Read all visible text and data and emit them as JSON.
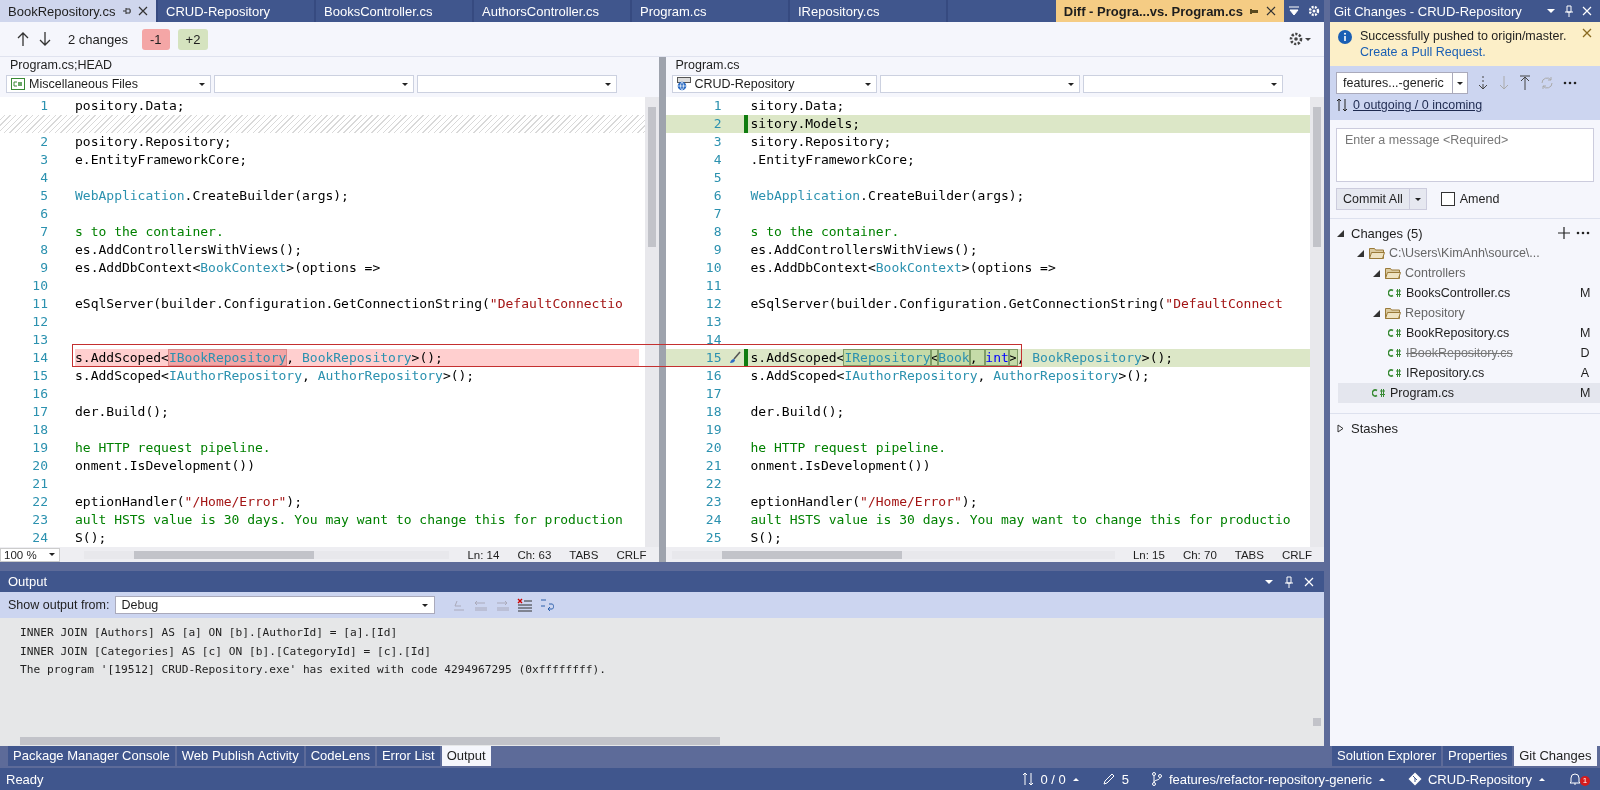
{
  "editor_tabs": [
    {
      "label": "BookRepository.cs",
      "selected": true,
      "pinned": true
    },
    {
      "label": "CRUD-Repository",
      "selected": false,
      "pinned": false
    },
    {
      "label": "BooksController.cs",
      "selected": false,
      "pinned": false
    },
    {
      "label": "AuthorsController.cs",
      "selected": false,
      "pinned": false
    },
    {
      "label": "Program.cs",
      "selected": false,
      "pinned": false
    },
    {
      "label": "IRepository.cs",
      "selected": false,
      "pinned": false
    }
  ],
  "diff_tab": {
    "label": "Diff - Progra...vs. Program.cs"
  },
  "diff_toolbar": {
    "changes": "2 changes",
    "removed": "-1",
    "added": "+2"
  },
  "panes": [
    {
      "title": "Program.cs;HEAD",
      "project": "Miscellaneous Files",
      "kind": "csharp",
      "zoom": "100 %",
      "status": [
        "Ln: 14",
        "Ch: 63",
        "TABS",
        "CRLF"
      ],
      "lines": [
        {
          "num": "1",
          "kind": "same",
          "segs": [
            {
              "text": "pository.Data;",
              "kind": "plain",
              "changed": false
            }
          ]
        },
        {
          "kind": "filler"
        },
        {
          "num": "2",
          "kind": "same",
          "segs": [
            {
              "text": "pository.Repository;",
              "kind": "plain",
              "changed": false
            }
          ]
        },
        {
          "num": "3",
          "kind": "same",
          "segs": [
            {
              "text": "e.EntityFrameworkCore;",
              "kind": "plain",
              "changed": false
            }
          ]
        },
        {
          "num": "4",
          "kind": "same"
        },
        {
          "num": "5",
          "kind": "same",
          "segs": [
            {
              "text": "WebApplication",
              "kind": "type",
              "changed": false
            },
            {
              "text": ".CreateBuilder(args);",
              "kind": "plain",
              "changed": false
            }
          ]
        },
        {
          "num": "6",
          "kind": "same"
        },
        {
          "num": "7",
          "kind": "same",
          "segs": [
            {
              "text": "s to the container.",
              "kind": "comment",
              "changed": false
            }
          ]
        },
        {
          "num": "8",
          "kind": "same",
          "segs": [
            {
              "text": "es.AddControllersWithViews();",
              "kind": "plain",
              "changed": false
            }
          ]
        },
        {
          "num": "9",
          "kind": "same",
          "segs": [
            {
              "text": "es.AddDbContext<",
              "kind": "plain",
              "changed": false
            },
            {
              "text": "BookContext",
              "kind": "type",
              "changed": false
            },
            {
              "text": ">(options =>",
              "kind": "plain",
              "changed": false
            }
          ]
        },
        {
          "num": "10",
          "kind": "same"
        },
        {
          "num": "11",
          "kind": "same",
          "segs": [
            {
              "text": "eSqlServer(builder.Configuration.GetConnectionString(",
              "kind": "plain",
              "changed": false
            },
            {
              "text": "\"DefaultConnectio",
              "kind": "string",
              "changed": false
            }
          ]
        },
        {
          "num": "12",
          "kind": "same"
        },
        {
          "num": "13",
          "kind": "same"
        },
        {
          "num": "14",
          "kind": "removed",
          "segs": [
            {
              "text": "s.AddScoped<",
              "kind": "plain",
              "changed": false
            },
            {
              "text": "IBookRepository",
              "kind": "type",
              "changed": true
            },
            {
              "text": ", ",
              "kind": "plain",
              "changed": false
            },
            {
              "text": "BookRepository",
              "kind": "type",
              "changed": false
            },
            {
              "text": ">();",
              "kind": "plain",
              "changed": false
            }
          ]
        },
        {
          "num": "15",
          "kind": "same",
          "segs": [
            {
              "text": "s.AddScoped<",
              "kind": "plain",
              "changed": false
            },
            {
              "text": "IAuthorRepository",
              "kind": "type",
              "changed": false
            },
            {
              "text": ", ",
              "kind": "plain",
              "changed": false
            },
            {
              "text": "AuthorRepository",
              "kind": "type",
              "changed": false
            },
            {
              "text": ">();",
              "kind": "plain",
              "changed": false
            }
          ]
        },
        {
          "num": "16",
          "kind": "same"
        },
        {
          "num": "17",
          "kind": "same",
          "segs": [
            {
              "text": "der.Build();",
              "kind": "plain",
              "changed": false
            }
          ]
        },
        {
          "num": "18",
          "kind": "same"
        },
        {
          "num": "19",
          "kind": "same",
          "segs": [
            {
              "text": "he HTTP request pipeline.",
              "kind": "comment",
              "changed": false
            }
          ]
        },
        {
          "num": "20",
          "kind": "same",
          "segs": [
            {
              "text": "onment.IsDevelopment())",
              "kind": "plain",
              "changed": false
            }
          ]
        },
        {
          "num": "21",
          "kind": "same"
        },
        {
          "num": "22",
          "kind": "same",
          "segs": [
            {
              "text": "eptionHandler(",
              "kind": "plain",
              "changed": false
            },
            {
              "text": "\"/Home/Error\"",
              "kind": "string",
              "changed": false
            },
            {
              "text": ");",
              "kind": "plain",
              "changed": false
            }
          ]
        },
        {
          "num": "23",
          "kind": "same",
          "segs": [
            {
              "text": "ault HSTS value is 30 days. You may want to change this for production",
              "kind": "comment",
              "changed": false
            }
          ]
        },
        {
          "num": "24",
          "kind": "same",
          "segs": [
            {
              "text": "S();",
              "kind": "plain",
              "changed": false
            }
          ]
        }
      ]
    },
    {
      "title": "Program.cs",
      "project": "CRUD-Repository",
      "kind": "web",
      "status": [
        "Ln: 15",
        "Ch: 70",
        "TABS",
        "CRLF"
      ],
      "lines": [
        {
          "num": "1",
          "kind": "same",
          "segs": [
            {
              "text": "sitory.Data;",
              "kind": "plain",
              "changed": false
            }
          ]
        },
        {
          "num": "2",
          "kind": "added",
          "segs": [
            {
              "text": "sitory.Models;",
              "kind": "plain",
              "changed": false
            }
          ]
        },
        {
          "num": "3",
          "kind": "same",
          "segs": [
            {
              "text": "sitory.Repository;",
              "kind": "plain",
              "changed": false
            }
          ]
        },
        {
          "num": "4",
          "kind": "same",
          "segs": [
            {
              "text": ".EntityFrameworkCore;",
              "kind": "plain",
              "changed": false
            }
          ]
        },
        {
          "num": "5",
          "kind": "same"
        },
        {
          "num": "6",
          "kind": "same",
          "segs": [
            {
              "text": "WebApplication",
              "kind": "type",
              "changed": false
            },
            {
              "text": ".CreateBuilder(args);",
              "kind": "plain",
              "changed": false
            }
          ]
        },
        {
          "num": "7",
          "kind": "same"
        },
        {
          "num": "8",
          "kind": "same",
          "segs": [
            {
              "text": "s to the container.",
              "kind": "comment",
              "changed": false
            }
          ]
        },
        {
          "num": "9",
          "kind": "same",
          "segs": [
            {
              "text": "es.AddControllersWithViews();",
              "kind": "plain",
              "changed": false
            }
          ]
        },
        {
          "num": "10",
          "kind": "same",
          "segs": [
            {
              "text": "es.AddDbContext<",
              "kind": "plain",
              "changed": false
            },
            {
              "text": "BookContext",
              "kind": "type",
              "changed": false
            },
            {
              "text": ">(options =>",
              "kind": "plain",
              "changed": false
            }
          ]
        },
        {
          "num": "11",
          "kind": "same"
        },
        {
          "num": "12",
          "kind": "same",
          "segs": [
            {
              "text": "eSqlServer(builder.Configuration.GetConnectionString(",
              "kind": "plain",
              "changed": false
            },
            {
              "text": "\"DefaultConnect",
              "kind": "string",
              "changed": false
            }
          ]
        },
        {
          "num": "13",
          "kind": "same"
        },
        {
          "num": "14",
          "kind": "same"
        },
        {
          "num": "15",
          "kind": "added",
          "segs": [
            {
              "text": "s.AddScoped<",
              "kind": "plain",
              "changed": false
            },
            {
              "text": "IRepository",
              "kind": "type",
              "changed": true
            },
            {
              "text": "<",
              "kind": "plain",
              "changed": true
            },
            {
              "text": "Book",
              "kind": "type",
              "changed": true
            },
            {
              "text": ", ",
              "kind": "plain",
              "changed": true
            },
            {
              "text": "int",
              "kind": "keyword",
              "changed": true
            },
            {
              "text": ">",
              "kind": "plain",
              "changed": true
            },
            {
              "text": ", ",
              "kind": "plain",
              "changed": false
            },
            {
              "text": "BookRepository",
              "kind": "type",
              "changed": false
            },
            {
              "text": ">();",
              "kind": "plain",
              "changed": false
            }
          ]
        },
        {
          "num": "16",
          "kind": "same",
          "segs": [
            {
              "text": "s.AddScoped<",
              "kind": "plain",
              "changed": false
            },
            {
              "text": "IAuthorRepository",
              "kind": "type",
              "changed": false
            },
            {
              "text": ", ",
              "kind": "plain",
              "changed": false
            },
            {
              "text": "AuthorRepository",
              "kind": "type",
              "changed": false
            },
            {
              "text": ">();",
              "kind": "plain",
              "changed": false
            }
          ]
        },
        {
          "num": "17",
          "kind": "same"
        },
        {
          "num": "18",
          "kind": "same",
          "segs": [
            {
              "text": "der.Build();",
              "kind": "plain",
              "changed": false
            }
          ]
        },
        {
          "num": "19",
          "kind": "same"
        },
        {
          "num": "20",
          "kind": "same",
          "segs": [
            {
              "text": "he HTTP request pipeline.",
              "kind": "comment",
              "changed": false
            }
          ]
        },
        {
          "num": "21",
          "kind": "same",
          "segs": [
            {
              "text": "onment.IsDevelopment())",
              "kind": "plain",
              "changed": false
            }
          ]
        },
        {
          "num": "22",
          "kind": "same"
        },
        {
          "num": "23",
          "kind": "same",
          "segs": [
            {
              "text": "eptionHandler(",
              "kind": "plain",
              "changed": false
            },
            {
              "text": "\"/Home/Error\"",
              "kind": "string",
              "changed": false
            },
            {
              "text": ");",
              "kind": "plain",
              "changed": false
            }
          ]
        },
        {
          "num": "24",
          "kind": "same",
          "segs": [
            {
              "text": "ault HSTS value is 30 days. You may want to change this for productio",
              "kind": "comment",
              "changed": false
            }
          ]
        },
        {
          "num": "25",
          "kind": "same",
          "segs": [
            {
              "text": "S();",
              "kind": "plain",
              "changed": false
            }
          ]
        }
      ]
    }
  ],
  "output": {
    "title": "Output",
    "source_label": "Show output from:",
    "source": "Debug",
    "lines": [
      "INNER JOIN [Authors] AS [a] ON [b].[AuthorId] = [a].[Id]",
      "INNER JOIN [Categories] AS [c] ON [b].[CategoryId] = [c].[Id]",
      "The program '[19512] CRUD-Repository.exe' has exited with code 4294967295 (0xffffffff)."
    ]
  },
  "bottom_tabs": [
    {
      "label": "Package Manager Console",
      "selected": false
    },
    {
      "label": "Web Publish Activity",
      "selected": false
    },
    {
      "label": "CodeLens",
      "selected": false
    },
    {
      "label": "Error List",
      "selected": false
    },
    {
      "label": "Output",
      "selected": true
    }
  ],
  "git_panel": {
    "title": "Git Changes - CRUD-Repository",
    "notice": {
      "message": "Successfully pushed to origin/master.",
      "link": "Create a Pull Request."
    },
    "branch": "features...-generic",
    "sync_link": "0 outgoing / 0 incoming",
    "message_placeholder": "Enter a message <Required>",
    "commit_button": "Commit All",
    "amend": {
      "label": "Amend",
      "checked": false
    },
    "sections": [
      {
        "label": "Changes (5)",
        "expanded": true,
        "children": [
          {
            "label": "C:\\Users\\KimAnh\\source\\...",
            "kind": "folder",
            "expanded": true,
            "children": [
              {
                "label": "Controllers",
                "kind": "folder",
                "expanded": true,
                "children": [
                  {
                    "label": "BooksController.cs",
                    "kind": "file",
                    "status": "M",
                    "deleted": false,
                    "selected": false
                  }
                ]
              },
              {
                "label": "Repository",
                "kind": "folder",
                "expanded": true,
                "children": [
                  {
                    "label": "BookRepository.cs",
                    "kind": "file",
                    "status": "M",
                    "deleted": false,
                    "selected": false
                  },
                  {
                    "label": "IBookRepository.cs",
                    "kind": "file",
                    "status": "D",
                    "deleted": true,
                    "selected": false
                  },
                  {
                    "label": "IRepository.cs",
                    "kind": "file",
                    "status": "A",
                    "deleted": false,
                    "selected": false
                  }
                ]
              },
              {
                "label": "Program.cs",
                "kind": "file",
                "status": "M",
                "deleted": false,
                "selected": true
              }
            ]
          }
        ]
      },
      {
        "label": "Stashes",
        "expanded": false
      }
    ],
    "tabs": [
      {
        "label": "Solution Explorer",
        "selected": false
      },
      {
        "label": "Properties",
        "selected": false
      },
      {
        "label": "Git Changes",
        "selected": true
      }
    ]
  },
  "status_bar": {
    "text": "Ready",
    "sync": "0 / 0",
    "edits": "5",
    "branch": "features/refactor-repository-generic",
    "repo": "CRUD-Repository",
    "notifications": "1"
  }
}
